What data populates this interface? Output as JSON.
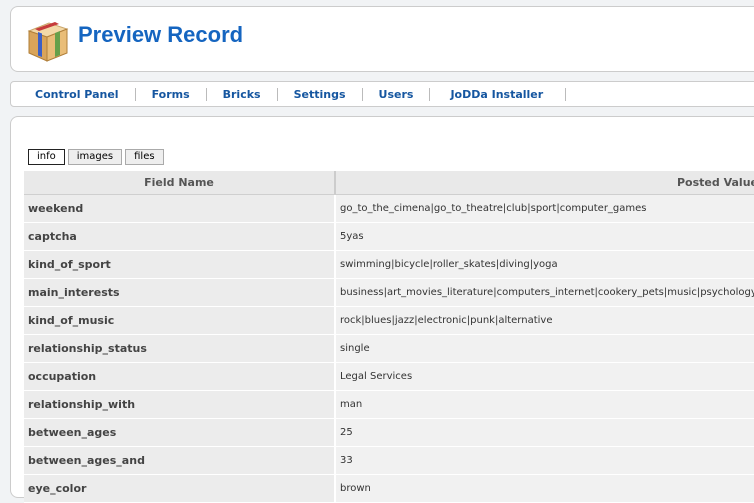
{
  "header": {
    "title": "Preview Record"
  },
  "nav": {
    "items": [
      {
        "label": "Control Panel"
      },
      {
        "label": "Forms"
      },
      {
        "label": "Bricks"
      },
      {
        "label": "Settings"
      },
      {
        "label": "Users"
      },
      {
        "label": "JoDDa Installer"
      }
    ]
  },
  "tabs": [
    {
      "label": "info",
      "active": true
    },
    {
      "label": "images",
      "active": false
    },
    {
      "label": "files",
      "active": false
    }
  ],
  "table": {
    "headers": {
      "field": "Field Name",
      "value": "Posted Value"
    },
    "rows": [
      {
        "field": "weekend",
        "value": "go_to_the_cimena|go_to_theatre|club|sport|computer_games"
      },
      {
        "field": "captcha",
        "value": "5yas"
      },
      {
        "field": "kind_of_sport",
        "value": "swimming|bicycle|roller_skates|diving|yoga"
      },
      {
        "field": "main_interests",
        "value": "business|art_movies_literature|computers_internet|cookery_pets|music|psychology"
      },
      {
        "field": "kind_of_music",
        "value": "rock|blues|jazz|electronic|punk|alternative"
      },
      {
        "field": "relationship_status",
        "value": "single"
      },
      {
        "field": "occupation",
        "value": "Legal Services"
      },
      {
        "field": "relationship_with",
        "value": "man"
      },
      {
        "field": "between_ages",
        "value": "25"
      },
      {
        "field": "between_ages_and",
        "value": "33"
      },
      {
        "field": "eye_color",
        "value": "brown"
      }
    ]
  }
}
